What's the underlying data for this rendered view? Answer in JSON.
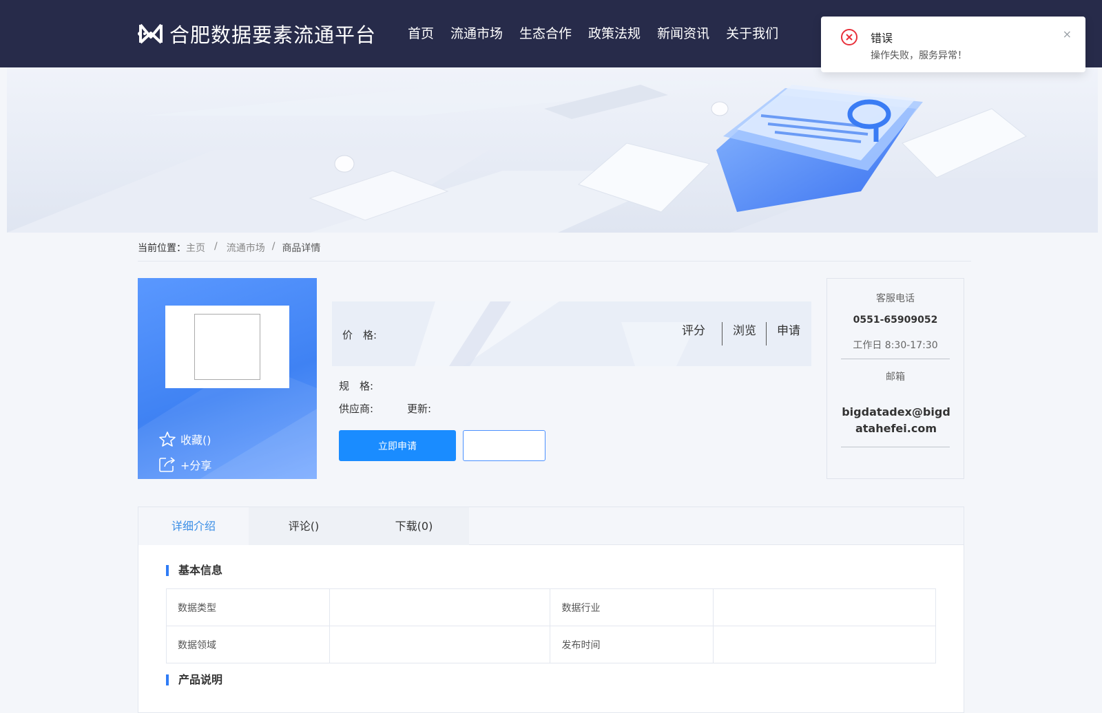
{
  "header": {
    "title": "合肥数据要素流通平台",
    "nav": [
      "首页",
      "流通市场",
      "生态合作",
      "政策法规",
      "新闻资讯",
      "关于我们"
    ]
  },
  "toast": {
    "title": "错误",
    "message": "操作失败，服务异常！",
    "close": "×"
  },
  "breadcrumb": {
    "prefix": "当前位置：",
    "items": [
      "主页",
      "流通市场",
      "商品详情"
    ],
    "separator": "/"
  },
  "product": {
    "favorite_label": "收藏()",
    "share_label": "+分享",
    "price_label": "价　格:",
    "stats": [
      "评分",
      "浏览",
      "申请"
    ],
    "spec_label": "规　格:",
    "supplier_label": "供应商:",
    "update_label": "更新:",
    "apply_button": "立即申请",
    "secondary_button": ""
  },
  "contact": {
    "phone_label": "客服电话",
    "phone": "0551-65909052",
    "hours": "工作日 8:30-17:30",
    "email_label": "邮箱",
    "email": "bigdatadex@bigdatahefei.com"
  },
  "tabs": [
    "详细介绍",
    "评论()",
    "下载(0)"
  ],
  "basic_info": {
    "title": "基本信息",
    "rows": [
      [
        "数据类型",
        "",
        "数据行业",
        ""
      ],
      [
        "数据领域",
        "",
        "发布时间",
        ""
      ]
    ]
  },
  "product_desc_title": "产品说明",
  "colors": {
    "header_bg": "#272b4a",
    "accent": "#1a8cff",
    "error": "#e8303a",
    "active_tab": "#3a8ee6"
  }
}
